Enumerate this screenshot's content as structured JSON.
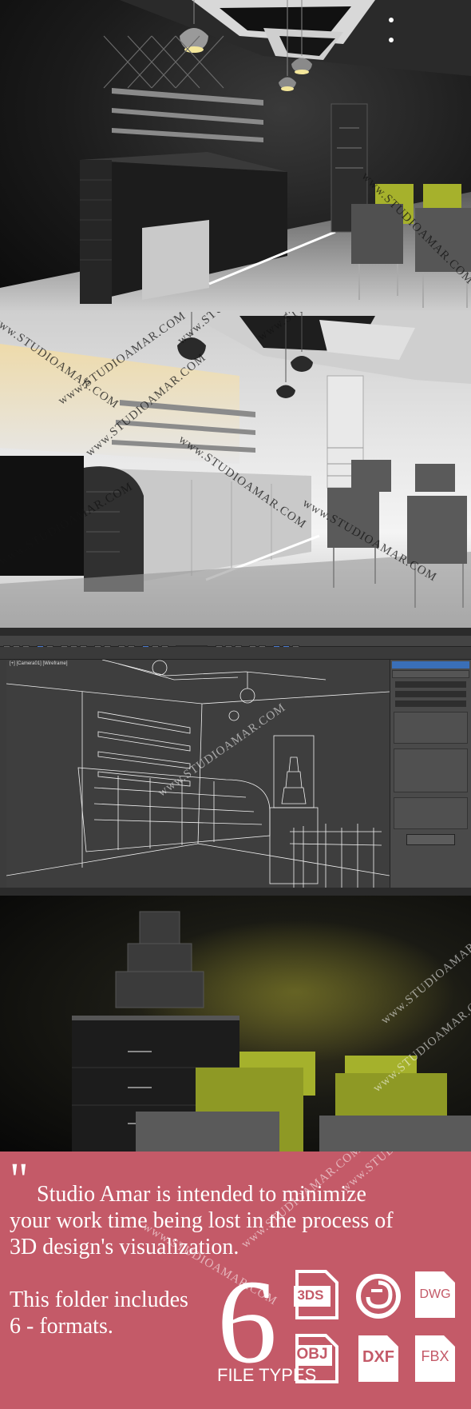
{
  "watermark_text": "www.STUDIOAMAR.COM",
  "promo": {
    "quote_mark": "\"",
    "line1": "Studio Amar is intended to minimize",
    "line2": "your work time being lost in the process of",
    "line3": "3D design's visualization.",
    "line4": "This folder includes",
    "line5": "6 - formats.",
    "big_number": "6",
    "file_types_label": "FILE TYPES"
  },
  "formats": [
    {
      "label": "3DS",
      "icon": "3ds-file-icon"
    },
    {
      "label": "",
      "icon": "3ds-max-logo-icon"
    },
    {
      "label": "DWG",
      "icon": "dwg-file-icon"
    },
    {
      "label": "OBJ",
      "icon": "obj-file-icon"
    },
    {
      "label": "DXF",
      "icon": "dxf-file-icon"
    },
    {
      "label": "FBX",
      "icon": "fbx-file-icon"
    }
  ],
  "colors": {
    "promo_background": "#c45a68",
    "chair_accent": "#b7c23a",
    "led_strip": "#fffbe8"
  }
}
